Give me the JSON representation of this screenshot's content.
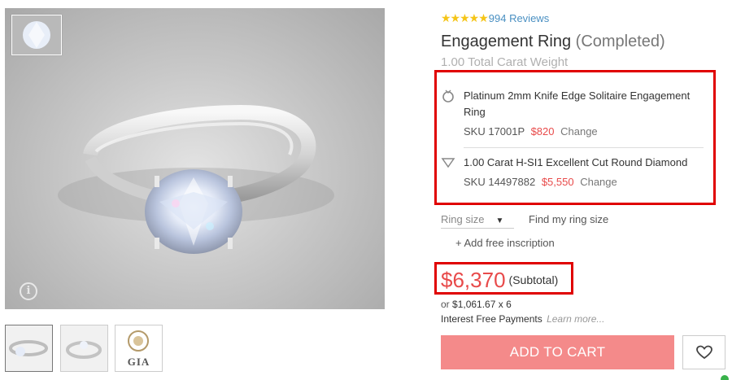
{
  "rating": {
    "stars": "★★★★★",
    "reviews": "994 Reviews"
  },
  "product": {
    "title": "Engagement Ring",
    "status": "(Completed)",
    "carat_weight": "1.00 Total Carat Weight"
  },
  "setting": {
    "name": "Platinum 2mm Knife Edge Solitaire Engagement Ring",
    "sku": "SKU 17001P",
    "price": "$820",
    "change": "Change",
    "icon": "ring-icon"
  },
  "diamond": {
    "name": "1.00 Carat H-SI1 Excellent Cut Round Diamond",
    "sku": "SKU 14497882",
    "price": "$5,550",
    "change": "Change",
    "icon": "diamond-icon"
  },
  "options": {
    "ring_size": "Ring size",
    "find_size": "Find my ring size",
    "inscription": "+ Add free inscription"
  },
  "pricing": {
    "subtotal": "$6,370",
    "subtotal_label": "(Subtotal)",
    "financing_prefix": "or",
    "financing_amount": "$1,061.67 x 6",
    "interest": "Interest Free Payments",
    "learn_more": "Learn more..."
  },
  "actions": {
    "add_to_cart": "ADD TO CART",
    "wishlist_icon": "heart-icon"
  },
  "gallery": {
    "thumbs": [
      "ring-side-view",
      "ring-angle-view",
      "gia-certificate"
    ],
    "gia_label": "GIA"
  },
  "colors": {
    "accent_price": "#e84a4a",
    "cart_button": "#f48a8a",
    "review_link": "#4a90c2",
    "star": "#f5c518",
    "highlight": "#e00000"
  }
}
